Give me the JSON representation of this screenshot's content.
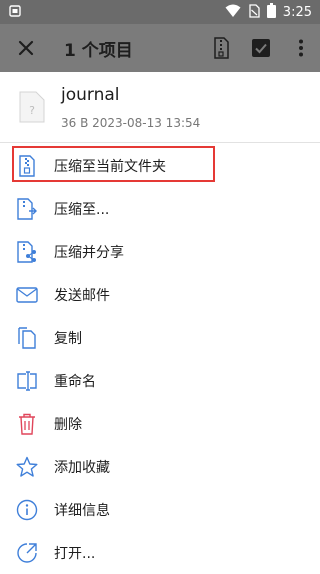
{
  "status_bar": {
    "time": "3:25",
    "icons": [
      "notification-icon",
      "wifi-icon",
      "no-sim-icon",
      "battery-icon"
    ]
  },
  "toolbar": {
    "title": "1 个项目",
    "icons": [
      "close-icon",
      "archive-icon",
      "select-all-icon",
      "more-icon"
    ]
  },
  "file": {
    "name": "journal",
    "meta": "36 B  2023-08-13 13:54"
  },
  "menu": {
    "items": [
      {
        "label": "压缩至当前文件夹",
        "icon": "zip-icon"
      },
      {
        "label": "压缩至...",
        "icon": "zip-to-icon"
      },
      {
        "label": "压缩并分享",
        "icon": "zip-share-icon"
      },
      {
        "label": "发送邮件",
        "icon": "mail-icon"
      },
      {
        "label": "复制",
        "icon": "copy-icon"
      },
      {
        "label": "重命名",
        "icon": "rename-icon"
      },
      {
        "label": "删除",
        "icon": "trash-icon"
      },
      {
        "label": "添加收藏",
        "icon": "star-icon"
      },
      {
        "label": "详细信息",
        "icon": "info-icon"
      },
      {
        "label": "打开...",
        "icon": "open-icon"
      }
    ]
  },
  "colors": {
    "accent": "#3f7fd9",
    "delete": "#e0455a",
    "highlight": "#e53935"
  }
}
